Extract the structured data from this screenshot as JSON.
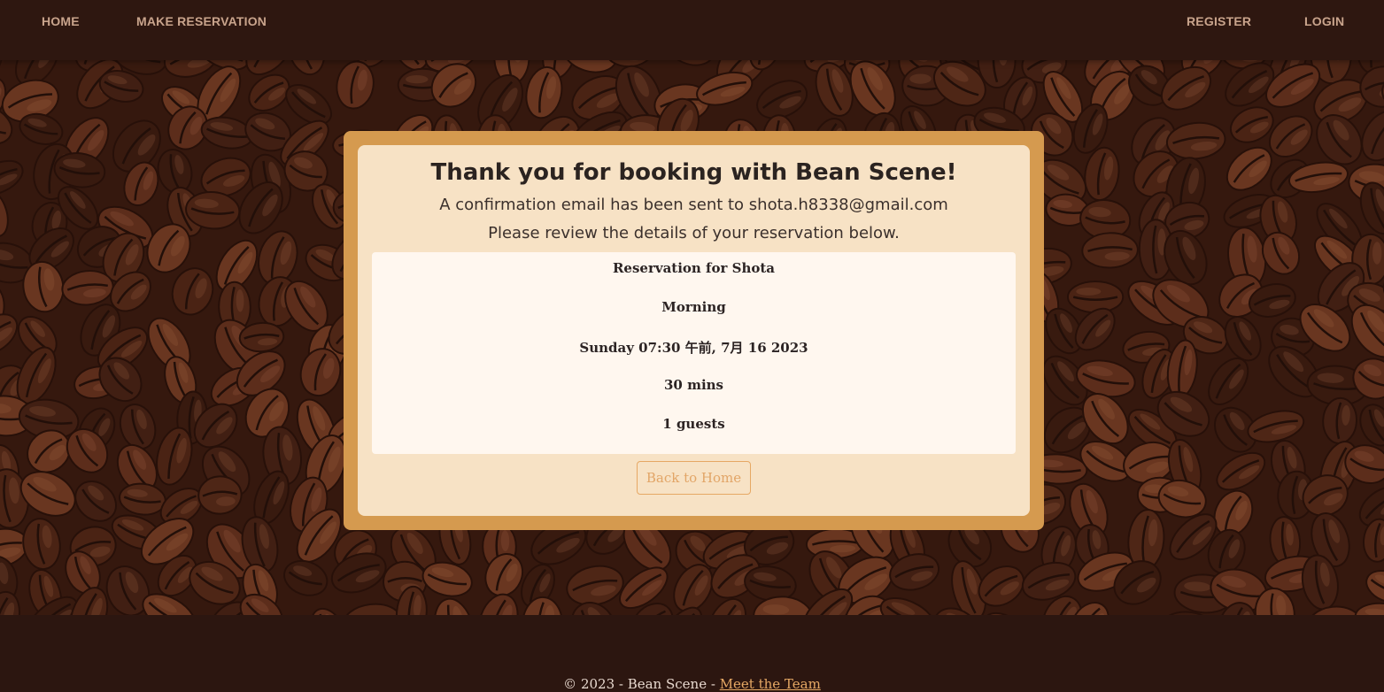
{
  "nav": {
    "home": "HOME",
    "make_reservation": "MAKE RESERVATION",
    "register": "REGISTER",
    "login": "LOGIN"
  },
  "card": {
    "title": "Thank you for booking with Bean Scene!",
    "email_line": "A confirmation email has been sent to shota.h8338@gmail.com",
    "review_line": "Please review the details of your reservation below.",
    "details": {
      "name": "Reservation for Shota",
      "sitting": "Morning",
      "datetime": "Sunday 07:30 午前, 7月 16 2023",
      "duration": "30 mins",
      "guests": "1 guests"
    },
    "back_button": "Back to Home"
  },
  "footer": {
    "copyright": "© 2023 - Bean Scene - ",
    "team_link": "Meet the Team"
  },
  "colors": {
    "nav_bg": "#2e1710",
    "card_frame": "#d59a4f",
    "card_bg": "#f7e2c5",
    "details_bg": "#fff7ef",
    "accent": "#e6a864"
  }
}
